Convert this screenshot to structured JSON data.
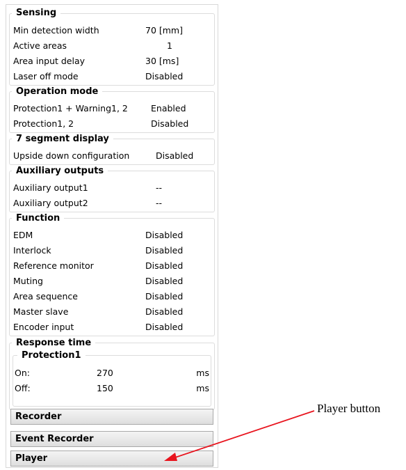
{
  "sensing": {
    "title": "Sensing",
    "rows": [
      {
        "label": "Min detection width",
        "value": "70 [mm]"
      },
      {
        "label": "Active areas",
        "value": "1"
      },
      {
        "label": "Area input delay",
        "value": "30 [ms]"
      },
      {
        "label": "Laser off mode",
        "value": "Disabled"
      }
    ]
  },
  "operation_mode": {
    "title": "Operation mode",
    "rows": [
      {
        "label": "Protection1 + Warning1, 2",
        "value": "Enabled"
      },
      {
        "label": "Protection1, 2",
        "value": "Disabled"
      }
    ]
  },
  "segment_display": {
    "title": "7 segment display",
    "rows": [
      {
        "label": "Upside down configuration",
        "value": "Disabled"
      }
    ]
  },
  "auxiliary_outputs": {
    "title": "Auxiliary outputs",
    "rows": [
      {
        "label": "Auxiliary output1",
        "value": "--"
      },
      {
        "label": "Auxiliary output2",
        "value": "--"
      }
    ]
  },
  "function": {
    "title": "Function",
    "rows": [
      {
        "label": "EDM",
        "value": "Disabled"
      },
      {
        "label": "Interlock",
        "value": "Disabled"
      },
      {
        "label": "Reference monitor",
        "value": "Disabled"
      },
      {
        "label": "Muting",
        "value": "Disabled"
      },
      {
        "label": "Area sequence",
        "value": "Disabled"
      },
      {
        "label": "Master slave",
        "value": "Disabled"
      },
      {
        "label": "Encoder input",
        "value": "Disabled"
      }
    ]
  },
  "response_time": {
    "title": "Response time",
    "protection_title": "Protection1",
    "on": {
      "label": "On:",
      "value": "270",
      "unit": "ms"
    },
    "off": {
      "label": "Off:",
      "value": "150",
      "unit": "ms"
    }
  },
  "buttons": {
    "recorder": "Recorder",
    "event_recorder": "Event Recorder",
    "player": "Player"
  },
  "annotation": {
    "text": "Player button",
    "arrow_color": "#e8141e"
  }
}
